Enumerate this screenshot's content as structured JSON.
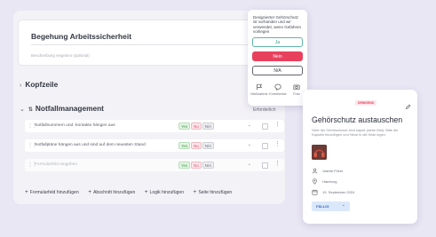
{
  "form": {
    "title": "Begehung Arbeitssicherheit",
    "description_placeholder": "Beschreibung eingeben (optional)"
  },
  "sections": {
    "header_section": "Kopfzeile",
    "emergency_section": "Notfallmanagement",
    "required_label": "Erforderlich"
  },
  "questions": [
    {
      "text": "Notfallnummern und -kontakte hängen aus",
      "answers": [
        "Yes",
        "No",
        "N/A"
      ]
    },
    {
      "text": "Notfallpläne hängen aus und sind auf dem neuesten Stand",
      "answers": [
        "Yes",
        "No",
        "N/A"
      ]
    },
    {
      "text": "Formularfeld eingeben",
      "answers": [
        "Yes",
        "No",
        "N/A"
      ],
      "is_placeholder": true
    }
  ],
  "toolbar": {
    "add_field": "Formularfeld hinzufügen",
    "add_section": "Abschnitt hinzufügen",
    "add_logic": "Logik hinzufügen",
    "add_page": "Seite hinzufügen"
  },
  "popup": {
    "question": "Designierter Gehörschutz ist vorhanden und wir verwendet, wenn Gefahren vorliegen",
    "buttons": {
      "ja": "Ja",
      "nein": "Nein",
      "na": "N/A"
    },
    "actions": {
      "report": "Maßnahme",
      "comment": "Kommentar",
      "photo": "Foto"
    }
  },
  "task_card": {
    "badge": "DRINGEND",
    "title": "Gehörschutz austauschen",
    "description": "Viele der Gehörschutze sind kaputt (siehe Bild). Bitte die Kapseln hinzufügen und Neue in die Kiste legen.",
    "assignee": "Valerie Pilzer",
    "location": "Hamburg",
    "due_date": "19. September 2024",
    "status": "FÄLLIG"
  },
  "colors": {
    "background": "#e9e7f4",
    "yes_green": "#3b9a45",
    "no_red": "#d74a5f",
    "accent_red": "#e8415e",
    "teal": "#5fb5a6",
    "status_blue": "#3566b8"
  }
}
